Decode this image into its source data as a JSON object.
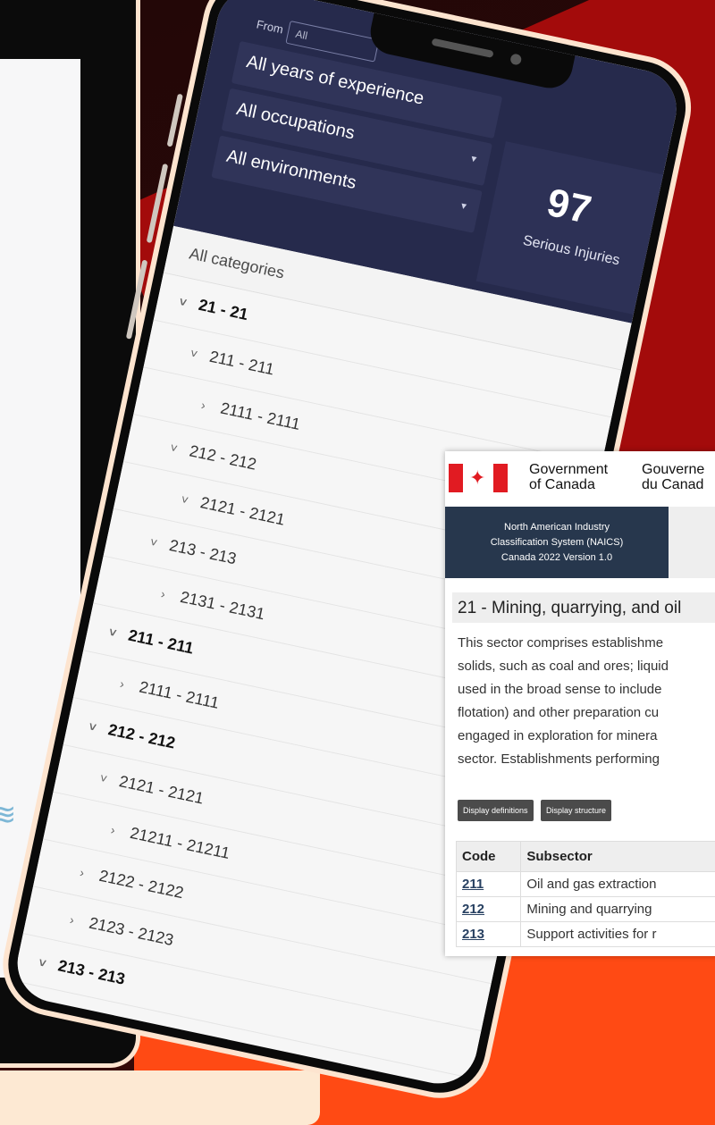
{
  "app": {
    "filters": {
      "from_label": "From",
      "from_value": "All",
      "experience": "All years of experience",
      "occupation": "All occupations",
      "environment": "All environments"
    },
    "stat": {
      "value": "97",
      "label": "Serious Injuries"
    },
    "tree": {
      "header": "All categories",
      "rows": [
        {
          "label": "21 - 21",
          "arrow": "˅",
          "bold": true
        },
        {
          "label": "211 - 211",
          "arrow": "˅",
          "bold": false
        },
        {
          "label": "2111 - 2111",
          "arrow": "›",
          "bold": false
        },
        {
          "label": "212 - 212",
          "arrow": "˅",
          "bold": false
        },
        {
          "label": "2121 - 2121",
          "arrow": "˅",
          "bold": false
        },
        {
          "label": "213 - 213",
          "arrow": "˅",
          "bold": false
        },
        {
          "label": "2131 - 2131",
          "arrow": "›",
          "bold": false
        },
        {
          "label": "211 - 211",
          "arrow": "˅",
          "bold": true
        },
        {
          "label": "2111 - 2111",
          "arrow": "›",
          "bold": false
        },
        {
          "label": "212 - 212",
          "arrow": "˅",
          "bold": true
        },
        {
          "label": "2121 - 2121",
          "arrow": "˅",
          "bold": false
        },
        {
          "label": "21211 - 21211",
          "arrow": "›",
          "bold": false
        },
        {
          "label": "2122 - 2122",
          "arrow": "›",
          "bold": false
        },
        {
          "label": "2123 - 2123",
          "arrow": "›",
          "bold": false
        },
        {
          "label": "213 - 213",
          "arrow": "˅",
          "bold": true
        }
      ]
    }
  },
  "gc": {
    "gov_en_1": "Government",
    "gov_en_2": "of Canada",
    "gov_fr_1": "Gouverne",
    "gov_fr_2": "du Canad",
    "naics_1": "North American Industry",
    "naics_2": "Classification System (NAICS)",
    "naics_3": "Canada 2022 Version 1.0",
    "sector_title": "21 - Mining, quarrying, and oil",
    "description": [
      "This sector comprises establishme",
      "solids, such as coal and ores; liquid",
      "used in the broad sense to include",
      "flotation) and other preparation cu",
      "engaged in exploration for minera",
      "sector. Establishments performing"
    ],
    "buttons": [
      "Display definitions",
      "Display structure"
    ],
    "table": {
      "headers": [
        "Code",
        "Subsector"
      ],
      "rows": [
        {
          "code": "211",
          "name": "Oil and gas extraction"
        },
        {
          "code": "212",
          "name": "Mining and quarrying"
        },
        {
          "code": "213",
          "name": "Support activities for r"
        }
      ]
    }
  }
}
